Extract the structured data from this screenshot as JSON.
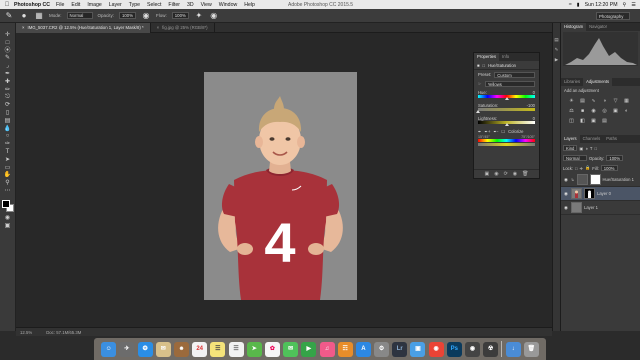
{
  "menubar": {
    "app_name": "Photoshop CC",
    "items": [
      "File",
      "Edit",
      "Image",
      "Layer",
      "Type",
      "Select",
      "Filter",
      "3D",
      "View",
      "Window",
      "Help"
    ],
    "window_title": "Adobe Photoshop CC 2015.5",
    "clock": "Sun 12:20 PM"
  },
  "options": {
    "mode_label": "Mode:",
    "mode_value": "Normal",
    "opacity_label": "Opacity:",
    "opacity_value": "100%",
    "flow_label": "Flow:",
    "flow_value": "100%",
    "workspace": "Photography"
  },
  "tabs": [
    {
      "label": "IMG_5037.CR2 @ 12.5% (Hue/Saturation 1, Layer Mask/8) *",
      "active": true
    },
    {
      "label": "fig.jpg @ 25% (RGB/8*)",
      "active": false
    }
  ],
  "status": {
    "zoom": "12.5%",
    "doc": "Doc: 57.1M/65.3M"
  },
  "properties": {
    "tab_properties": "Properties",
    "tab_info": "Info",
    "adjustment_title": "Hue/Saturation",
    "preset_label": "Preset:",
    "preset_value": "Custom",
    "channel_value": "Yellows",
    "hue_label": "Hue:",
    "hue_value": "0",
    "saturation_label": "Saturation:",
    "saturation_value": "-100",
    "lightness_label": "Lightness:",
    "lightness_value": "0",
    "colorize_label": "Colorize",
    "range_left": "15°/45°",
    "range_right": "75°/105°",
    "hue_level": 0.5,
    "saturation_level": 0.0,
    "lightness_level": 0.5
  },
  "right": {
    "tab_histogram": "Histogram",
    "tab_navigator": "Navigator",
    "tab_libraries": "Libraries",
    "tab_adjustments": "Adjustments",
    "add_adjustment": "Add an adjustment",
    "tab_layers": "Layers",
    "tab_channels": "Channels",
    "tab_paths": "Paths",
    "kind_label": "Kind",
    "blend_mode": "Normal",
    "opacity_label": "Opacity:",
    "opacity_value": "100%",
    "lock_label": "Lock:",
    "fill_label": "Fill:",
    "fill_value": "100%",
    "layers": [
      {
        "name": "Hue/Saturation 1",
        "active": false
      },
      {
        "name": "Layer 0",
        "active": true
      },
      {
        "name": "Layer 1",
        "active": false
      }
    ]
  },
  "photo": {
    "jersey_number": "4"
  },
  "dock": {
    "calendar_day": "24",
    "lightroom": "Lr",
    "photoshop": "Ps"
  },
  "colors": {
    "jersey": "#a8323a",
    "doc_background": "#8b8b8b",
    "active_layer": "#4b5566"
  }
}
